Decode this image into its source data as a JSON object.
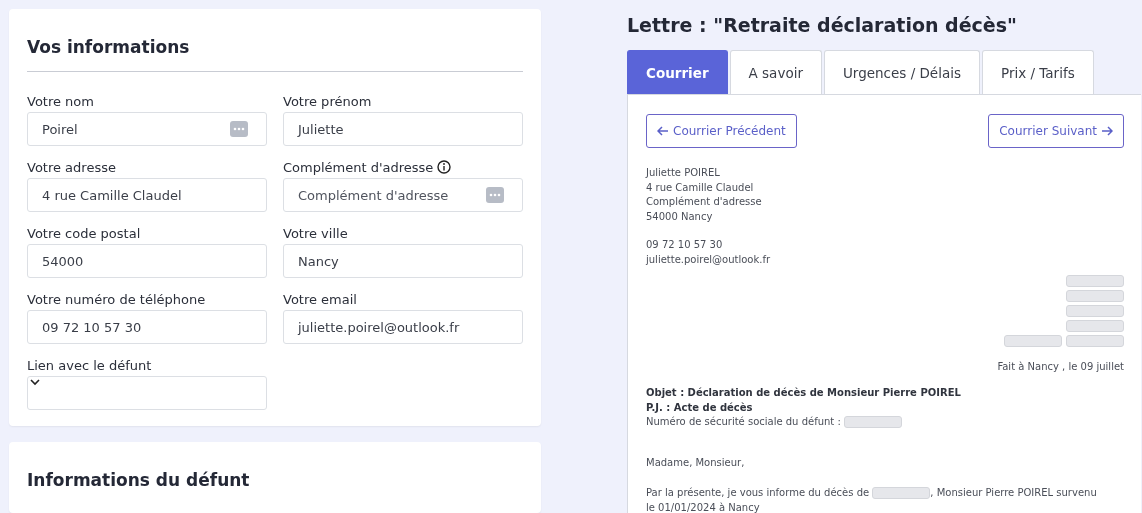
{
  "form_card": {
    "title": "Vos informations",
    "fields": [
      {
        "kind": "text",
        "label": "Votre nom",
        "value": "Poirel",
        "info": false,
        "autofill": true
      },
      {
        "kind": "text",
        "label": "Votre prénom",
        "value": "Juliette",
        "info": false,
        "autofill": false
      },
      {
        "kind": "text",
        "label": "Votre adresse",
        "value": "4 rue Camille Claudel",
        "info": false,
        "autofill": false
      },
      {
        "kind": "text",
        "label": "Complément d'adresse",
        "placeholder": "Complément d'adresse",
        "info": true,
        "autofill": true
      },
      {
        "kind": "text",
        "label": "Votre code postal",
        "value": "54000",
        "info": false,
        "autofill": false
      },
      {
        "kind": "text",
        "label": "Votre ville",
        "value": "Nancy",
        "info": false,
        "autofill": false
      },
      {
        "kind": "text",
        "label": "Votre numéro de téléphone",
        "value": "09 72 10 57 30",
        "info": false,
        "autofill": false
      },
      {
        "kind": "text",
        "label": "Votre email",
        "value": "juliette.poirel@outlook.fr",
        "info": false,
        "autofill": false
      },
      {
        "kind": "select",
        "label": "Lien avec le défunt"
      }
    ]
  },
  "second_card": {
    "title": "Informations du défunt"
  },
  "letter_title": "Lettre : \"Retraite déclaration décès\"",
  "tabs": [
    {
      "label": "Courrier",
      "selected": true
    },
    {
      "label": "A savoir",
      "selected": false
    },
    {
      "label": "Urgences / Délais",
      "selected": false
    },
    {
      "label": "Prix / Tarifs",
      "selected": false
    }
  ],
  "nav_buttons": {
    "previous": "Courrier Précédent",
    "next": "Courrier Suivant"
  },
  "letter": {
    "sender_lines": [
      "Juliette POIREL",
      "4 rue Camille Claudel",
      "Complément d'adresse",
      "54000 Nancy"
    ],
    "contact_lines": [
      "09 72 10 57 30",
      "juliette.poirel@outlook.fr"
    ],
    "place_date": "Fait à Nancy , le 09 juillet",
    "subject": "Objet : Déclaration de décès de Monsieur Pierre POIREL",
    "attachment": "P.J. : Acte de décès",
    "ssn_label": "Numéro de sécurité sociale du défunt :",
    "greeting": "Madame, Monsieur,",
    "body_before": "Par la présente, je vous informe du décès de",
    "body_after": ", Monsieur Pierre POIREL survenu",
    "body_continuation": "le 01/01/2024 à Nancy"
  }
}
